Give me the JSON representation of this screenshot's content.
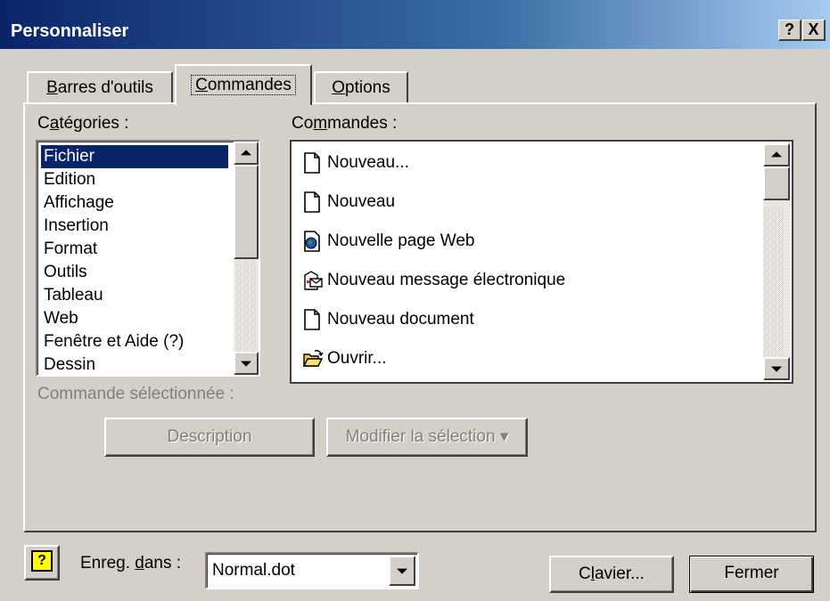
{
  "window": {
    "title": "Personnaliser",
    "help_button": "?",
    "close_button": "X"
  },
  "tabs": [
    {
      "label_pre": "",
      "accel": "B",
      "label_post": "arres d'outils"
    },
    {
      "label_pre": "",
      "accel": "C",
      "label_post": "ommandes"
    },
    {
      "label_pre": "",
      "accel": "O",
      "label_post": "ptions"
    }
  ],
  "categories": {
    "label_pre": "C",
    "label_accel": "a",
    "label_post": "tégories :",
    "items": [
      "Fichier",
      "Edition",
      "Affichage",
      "Insertion",
      "Format",
      "Outils",
      "Tableau",
      "Web",
      "Fenêtre et Aide (?)",
      "Dessin"
    ],
    "selected": "Fichier"
  },
  "commands": {
    "label_pre": "Co",
    "label_accel": "m",
    "label_post": "mandes :",
    "items": [
      {
        "label": "Nouveau...",
        "icon": "blank-document-icon"
      },
      {
        "label": "Nouveau",
        "icon": "blank-document-icon"
      },
      {
        "label": "Nouvelle page Web",
        "icon": "web-page-icon"
      },
      {
        "label": "Nouveau message électronique",
        "icon": "email-message-icon"
      },
      {
        "label": "Nouveau document",
        "icon": "blank-document-icon"
      },
      {
        "label": "Ouvrir...",
        "icon": "open-folder-icon"
      }
    ]
  },
  "selected_command": {
    "label": "Commande sélectionnée :",
    "description_button": "Description",
    "modify_button": "Modifier la sélection ▾"
  },
  "footer": {
    "save_label_pre": "Enreg. ",
    "save_label_accel": "d",
    "save_label_post": "ans :",
    "save_value": "Normal.dot",
    "keyboard_pre": "C",
    "keyboard_accel": "l",
    "keyboard_post": "avier...",
    "close_button": "Fermer"
  },
  "colors": {
    "title_gradient_start": "#0a246a",
    "title_gradient_end": "#a6caf0",
    "face": "#d4d0c8",
    "selection": "#0a246a"
  }
}
